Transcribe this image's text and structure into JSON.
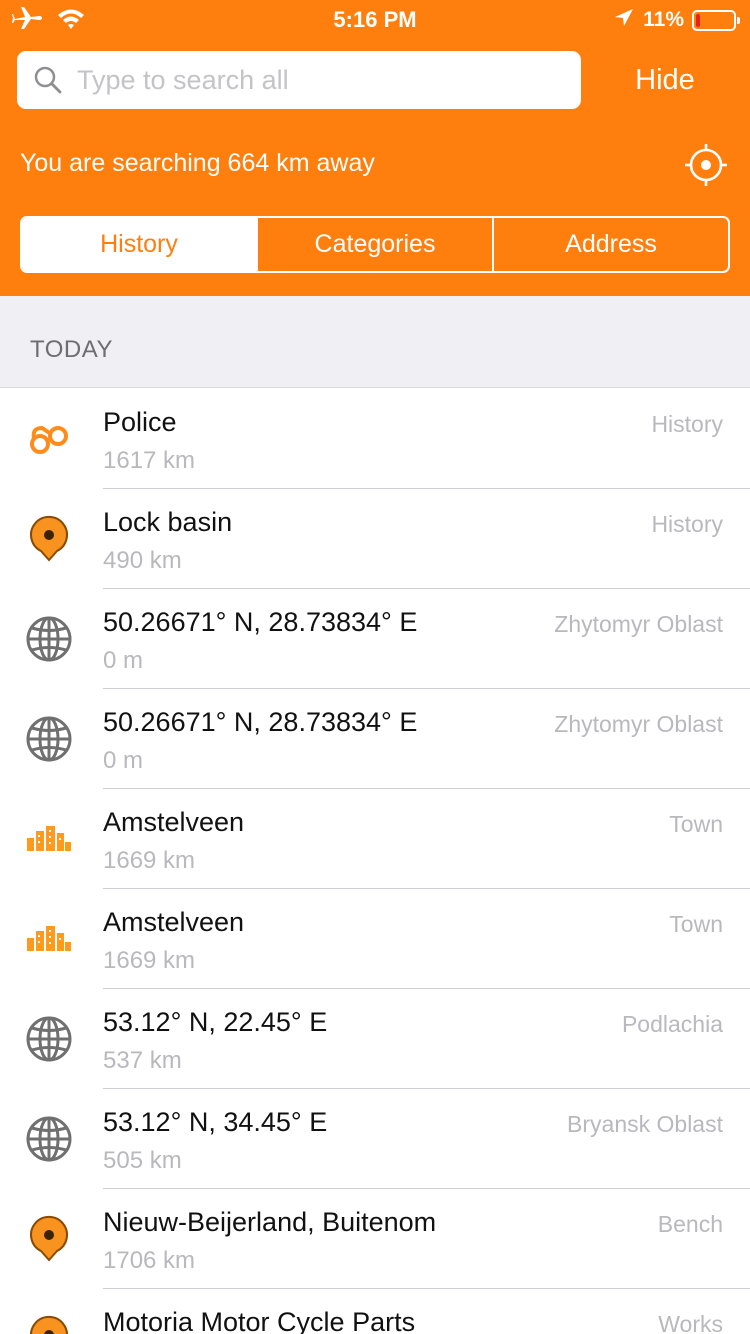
{
  "status_bar": {
    "time": "5:16 PM",
    "battery_percent": "11%",
    "battery_level": 0.11,
    "icons": [
      "airplane-icon",
      "wifi-icon",
      "location-arrow-icon",
      "battery-icon"
    ]
  },
  "search": {
    "placeholder": "Type to search all",
    "value": "",
    "hide_label": "Hide"
  },
  "search_info": "You are searching 664 km away",
  "tabs": [
    {
      "label": "History",
      "active": true
    },
    {
      "label": "Categories",
      "active": false
    },
    {
      "label": "Address",
      "active": false
    }
  ],
  "section_title": "TODAY",
  "colors": {
    "accent": "#ff7f0e",
    "grey_icon": "#707070",
    "secondary_text": "#b9b9bd"
  },
  "items": [
    {
      "title": "Police",
      "distance": "1617 km",
      "type": "History",
      "icon": "handcuffs-icon"
    },
    {
      "title": "Lock basin",
      "distance": "490 km",
      "type": "History",
      "icon": "pin-icon"
    },
    {
      "title": "50.26671° N, 28.73834° E",
      "distance": "0 m",
      "type": "Zhytomyr Oblast",
      "icon": "globe-icon"
    },
    {
      "title": "50.26671° N, 28.73834° E",
      "distance": "0 m",
      "type": "Zhytomyr Oblast",
      "icon": "globe-icon"
    },
    {
      "title": "Amstelveen",
      "distance": "1669 km",
      "type": "Town",
      "icon": "town-icon"
    },
    {
      "title": "Amstelveen",
      "distance": "1669 km",
      "type": "Town",
      "icon": "town-icon"
    },
    {
      "title": "53.12° N, 22.45° E",
      "distance": "537 km",
      "type": "Podlachia",
      "icon": "globe-icon"
    },
    {
      "title": "53.12° N, 34.45° E",
      "distance": "505 km",
      "type": "Bryansk Oblast",
      "icon": "globe-icon"
    },
    {
      "title": "Nieuw-Beijerland, Buitenom",
      "distance": "1706 km",
      "type": "Bench",
      "icon": "pin-icon"
    },
    {
      "title": "Motoria Motor Cycle Parts",
      "distance": "",
      "type": "Works",
      "icon": "pin-icon"
    }
  ]
}
